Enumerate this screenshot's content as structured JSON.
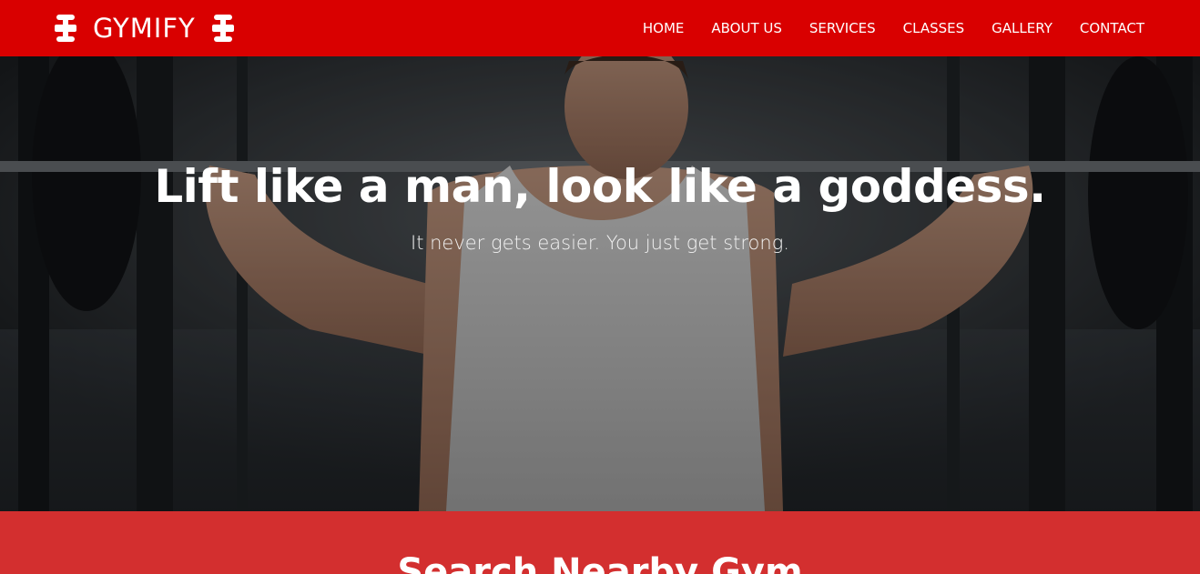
{
  "navbar": {
    "brand": "GYMIFY",
    "brand_icon": "dumbbell-icon",
    "background": "#d90000",
    "links": [
      {
        "label": "HOME"
      },
      {
        "label": "ABOUT US"
      },
      {
        "label": "SERVICES"
      },
      {
        "label": "CLASSES"
      },
      {
        "label": "GALLERY"
      },
      {
        "label": "CONTACT"
      }
    ]
  },
  "hero": {
    "title": "Lift like a man, look like a goddess.",
    "subtitle": "It never gets easier. You just get strong."
  },
  "search": {
    "heading": "Search Nearby Gym",
    "background": "#d32f2f"
  }
}
